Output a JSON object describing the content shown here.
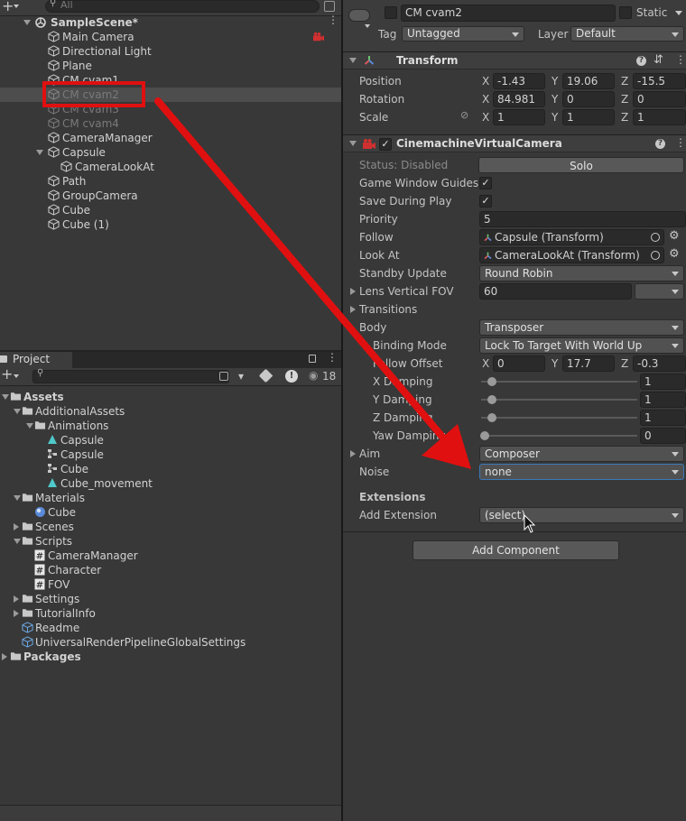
{
  "hierarchy": {
    "search_placeholder": "All",
    "scene_name": "SampleScene*",
    "items": [
      "Main Camera",
      "Directional Light",
      "Plane",
      "CM cvam1",
      "CM cvam2",
      "CM cvam3",
      "CM cvam4",
      "CameraManager",
      "Capsule",
      "CameraLookAt",
      "Path",
      "GroupCamera",
      "Cube",
      "Cube (1)"
    ]
  },
  "project": {
    "tab_label": "Project",
    "hidden_count": "18",
    "items": [
      "Assets",
      "AdditionalAssets",
      "Animations",
      "Capsule",
      "Capsule",
      "Cube",
      "Cube_movement",
      "Materials",
      "Cube",
      "Scenes",
      "Scripts",
      "CameraManager",
      "Character",
      "FOV",
      "Settings",
      "TutorialInfo",
      "Readme",
      "UniversalRenderPipelineGlobalSettings",
      "Packages"
    ]
  },
  "inspector": {
    "object_name": "CM cvam2",
    "static_label": "Static",
    "tag_label": "Tag",
    "tag_value": "Untagged",
    "layer_label": "Layer",
    "layer_value": "Default",
    "transform": {
      "title": "Transform",
      "position_label": "Position",
      "pos_x": "-1.43",
      "pos_y": "19.06",
      "pos_z": "-15.5",
      "rotation_label": "Rotation",
      "rot_x": "84.981",
      "rot_y": "0",
      "rot_z": "0",
      "scale_label": "Scale",
      "scl_x": "1",
      "scl_y": "1",
      "scl_z": "1"
    },
    "cmvc": {
      "title": "CinemachineVirtualCamera",
      "status_label": "Status: Disabled",
      "solo_label": "Solo",
      "gwg_label": "Game Window Guides",
      "sdp_label": "Save During Play",
      "priority_label": "Priority",
      "priority_value": "5",
      "follow_label": "Follow",
      "follow_value": "Capsule (Transform)",
      "lookat_label": "Look At",
      "lookat_value": "CameraLookAt (Transform)",
      "standby_label": "Standby Update",
      "standby_value": "Round Robin",
      "lens_label": "Lens Vertical FOV",
      "lens_value": "60",
      "transitions_label": "Transitions",
      "body_label": "Body",
      "body_value": "Transposer",
      "binding_label": "Binding Mode",
      "binding_value": "Lock To Target With World Up",
      "follow_offset_label": "Follow Offset",
      "fo_x": "0",
      "fo_y": "17.7",
      "fo_z": "-0.3",
      "xd_label": "X Damping",
      "xd_value": "1",
      "yd_label": "Y Damping",
      "yd_value": "1",
      "zd_label": "Z Damping",
      "zd_value": "1",
      "yawd_label": "Yaw Damping",
      "yawd_value": "0",
      "aim_label": "Aim",
      "aim_value": "Composer",
      "noise_label": "Noise",
      "noise_value": "none",
      "extensions_label": "Extensions",
      "add_ext_label": "Add Extension",
      "add_ext_value": "(select)"
    },
    "add_component_label": "Add Component"
  },
  "axis": {
    "x": "X",
    "y": "Y",
    "z": "Z"
  },
  "colors": {
    "annotation_red": "#e01010",
    "selection": "#4d4d4d",
    "focus_blue": "#3a79bb"
  }
}
